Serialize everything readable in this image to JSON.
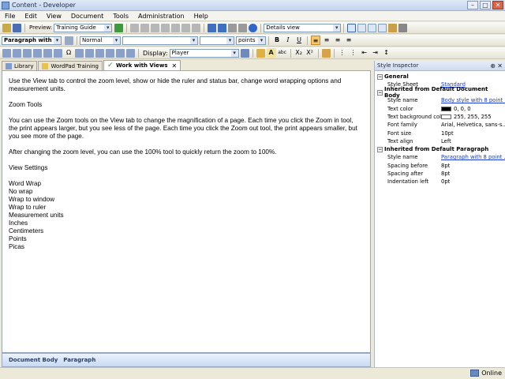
{
  "window": {
    "title": "Content - Developer"
  },
  "menu": [
    "File",
    "Edit",
    "View",
    "Document",
    "Tools",
    "Administration",
    "Help"
  ],
  "toolbar1": {
    "preview_label": "Preview:",
    "preview_value": "Training Guide",
    "view_value": "Details view"
  },
  "toolbar2": {
    "style_value": "Paragraph with 8 poin",
    "format_value": "Normal",
    "font_value": "",
    "size_value": "",
    "unit_value": "points"
  },
  "toolbar3": {
    "display_label": "Display:",
    "display_value": "Player"
  },
  "tabs": [
    "Library",
    "WordPad Training",
    "Work with Views"
  ],
  "document": {
    "lines": [
      "Use the View tab to control the zoom level, show or hide the ruler and status bar, change word wrapping options and measurement units.",
      "",
      "Zoom Tools",
      "",
      "You can use the Zoom tools on the View tab to change the magnification of a page. Each time you click the Zoom in tool, the print appears larger, but you see less of the page. Each time you click the Zoom out tool, the print appears smaller, but you see more of the page.",
      "",
      "After changing the zoom level, you can use the 100% tool to quickly return the zoom to 100%.",
      "",
      "View Settings",
      "",
      "Word Wrap",
      "No wrap",
      "Wrap to window",
      "Wrap to ruler",
      "Measurement units",
      "Inches",
      "Centimeters",
      "Points",
      "Picas"
    ]
  },
  "status": [
    "Document Body",
    "Paragraph"
  ],
  "inspector": {
    "title": "Style Inspector",
    "general": {
      "label": "General",
      "rows": [
        {
          "k": "Style Sheet",
          "v": "Standard",
          "link": true
        }
      ]
    },
    "body": {
      "label": "Inherited from Default Document Body",
      "rows": [
        {
          "k": "Style name",
          "v": "Body style with 8 point ...",
          "link": true
        },
        {
          "k": "Text color",
          "v": "0, 0, 0",
          "swatch": "#000000"
        },
        {
          "k": "Text background color",
          "v": "255, 255, 255",
          "swatch": "#ffffff"
        },
        {
          "k": "Font family",
          "v": "Arial, Helvetica, sans-s..."
        },
        {
          "k": "Font size",
          "v": "10pt"
        },
        {
          "k": "Text align",
          "v": "Left"
        }
      ]
    },
    "para": {
      "label": "Inherited from Default Paragraph",
      "rows": [
        {
          "k": "Style name",
          "v": "Paragraph with 8 point ...",
          "link": true
        },
        {
          "k": "Spacing before",
          "v": "8pt"
        },
        {
          "k": "Spacing after",
          "v": "8pt"
        },
        {
          "k": "Indentation left",
          "v": "0pt"
        }
      ]
    }
  },
  "statusbar": {
    "online": "Online"
  }
}
